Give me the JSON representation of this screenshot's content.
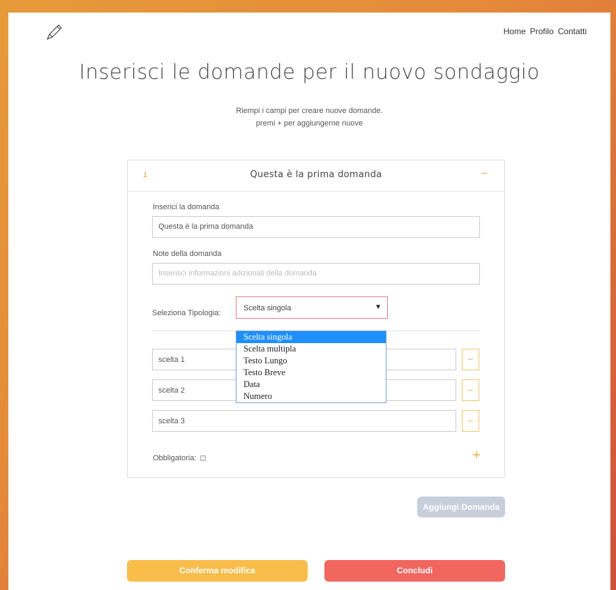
{
  "nav": {
    "home": "Home",
    "profile": "Profilo",
    "contacts": "Contatti"
  },
  "page_title": "Inserisci le domande per il nuovo sondaggio",
  "subtitle": {
    "line1": "Riempi i campi per creare nuove domande.",
    "line2": "premi + per aggiungerne nuove"
  },
  "question": {
    "number": "1",
    "title": "Questa è la prima domanda",
    "collapse_icon": "−",
    "text_label": "Inserici la domanda",
    "text_value": "Questa è la prima domanda",
    "notes_label": "Note della domanda",
    "notes_placeholder": "Inserisci informazioni adizionali della domanda",
    "type_label": "Seleziona Tipologia:",
    "type_selected": "Scelta singola",
    "type_options": [
      "Scelta singola",
      "Scelta multipla",
      "Testo Lungo",
      "Testo Breve",
      "Data",
      "Numero"
    ],
    "choices": [
      "scelta 1",
      "scelta 2",
      "scelta 3"
    ],
    "required_label": "Obbligatoria:",
    "add_choice_icon": "+",
    "remove_choice_icon": "−"
  },
  "buttons": {
    "add_question": "Aggiungi Domanda",
    "confirm": "Conferma modifica",
    "finish": "Concludi"
  },
  "colors": {
    "accent_orange": "#f9bd4c",
    "danger_red": "#f1665f",
    "disabled_gray": "#c7cfdb",
    "dropdown_highlight": "#1e90ff"
  },
  "icons": {
    "logo": "pencil-icon",
    "select_arrow": "caret-down-icon"
  }
}
